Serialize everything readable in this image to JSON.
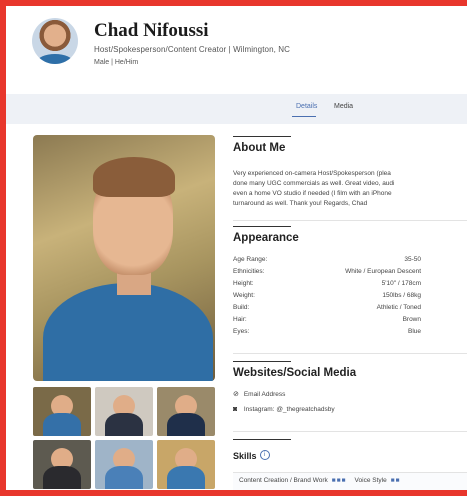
{
  "profile": {
    "name": "Chad Nifoussi",
    "roles": "Host/Spokesperson/Content Creator",
    "location": "Wilmington, NC",
    "sub_line": "Host/Spokesperson/Content Creator  |  Wilmington, NC",
    "gender_line": "Male  |  He/Him"
  },
  "tabs": [
    {
      "label": "Details",
      "active": true
    },
    {
      "label": "Media",
      "active": false
    }
  ],
  "about": {
    "title": "About Me",
    "lines": [
      "Very experienced on-camera Host/Spokesperson (plea",
      "done many UGC commercials as well. Great video, audi",
      "even a home VO studio if needed (I film with an iPhone",
      "turnaround as well. Thank you! Regards, Chad"
    ]
  },
  "appearance": {
    "title": "Appearance",
    "rows": [
      {
        "label": "Age Range:",
        "value": "35-50"
      },
      {
        "label": "Ethnicities:",
        "value": "White / European Descent"
      },
      {
        "label": "Height:",
        "value": "5'10\" / 178cm"
      },
      {
        "label": "Weight:",
        "value": "150lbs / 68kg"
      },
      {
        "label": "Build:",
        "value": "Athletic / Toned"
      },
      {
        "label": "Hair:",
        "value": "Brown"
      },
      {
        "label": "Eyes:",
        "value": "Blue"
      }
    ]
  },
  "websites": {
    "title": "Websites/Social Media",
    "items": [
      {
        "icon": "link-icon",
        "label": "Email Address"
      },
      {
        "icon": "instagram-icon",
        "label": "Instagram: @_thegreatchadsby"
      }
    ]
  },
  "skills": {
    "title": "Skills",
    "items": [
      "Content Creation / Brand Work",
      "Voice Style"
    ]
  },
  "colors": {
    "border": "#e8362c",
    "accent": "#4a6fb0",
    "shirt_blue": "#2f6ea5"
  }
}
